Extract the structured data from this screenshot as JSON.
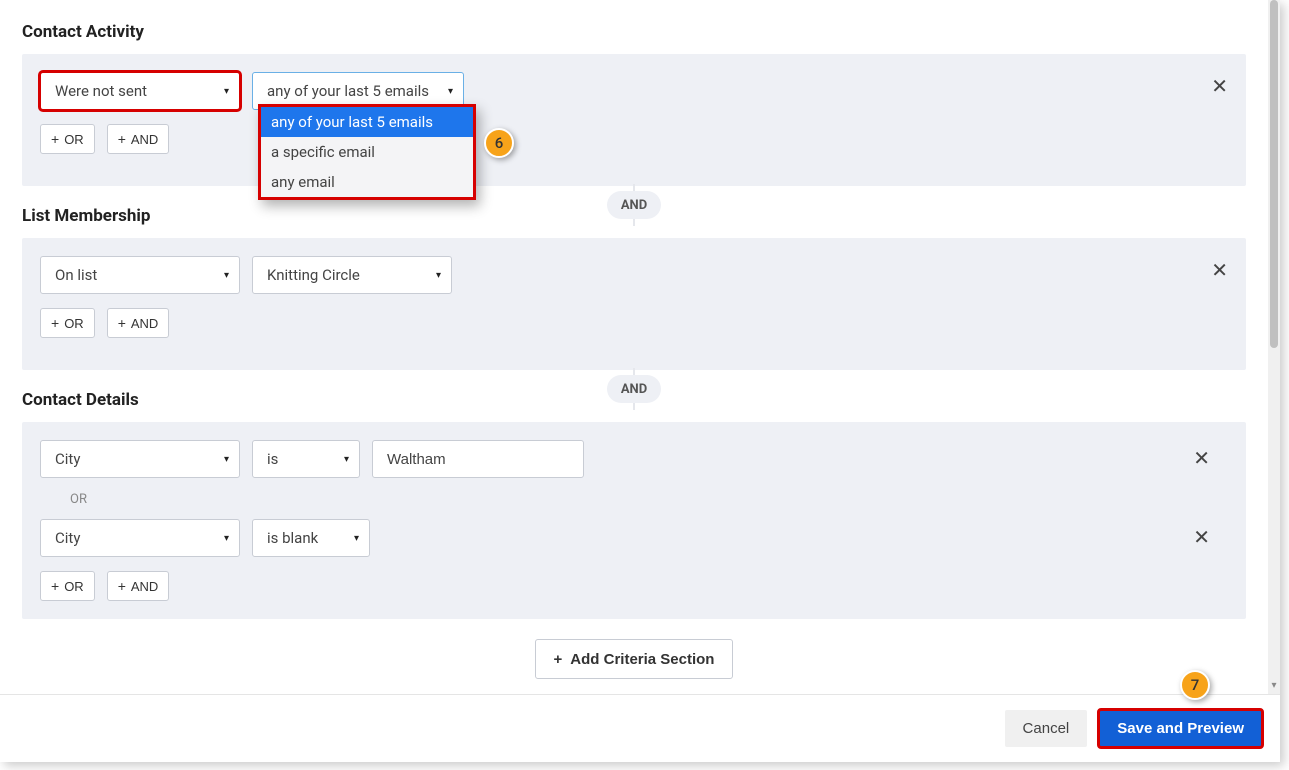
{
  "sections": {
    "contact_activity": {
      "title": "Contact Activity",
      "condition_select": "Were not sent",
      "scope_select": "any of your last 5 emails",
      "dropdown_options": {
        "opt1": "any of your last 5 emails",
        "opt2": "a specific email",
        "opt3": "any email"
      }
    },
    "list_membership": {
      "title": "List Membership",
      "status_select": "On list",
      "list_select": "Knitting Circle"
    },
    "contact_details": {
      "title": "Contact Details",
      "row1": {
        "field": "City",
        "op": "is",
        "value": "Waltham"
      },
      "or_label": "OR",
      "row2": {
        "field": "City",
        "op": "is blank"
      }
    }
  },
  "connectors": {
    "and": "AND"
  },
  "buttons": {
    "or": "OR",
    "and": "AND",
    "add_criteria": "Add Criteria Section",
    "cancel": "Cancel",
    "save_preview": "Save and Preview"
  },
  "callouts": {
    "c6": "6",
    "c7": "7"
  }
}
